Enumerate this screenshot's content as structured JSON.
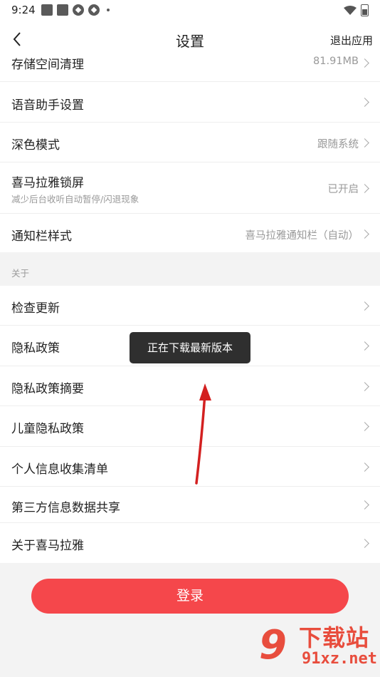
{
  "status": {
    "time": "9:24"
  },
  "header": {
    "title": "设置",
    "exit_label": "退出应用"
  },
  "settings": [
    {
      "label": "存储空间清理",
      "value": "81.91MB"
    },
    {
      "label": "语音助手设置",
      "value": ""
    },
    {
      "label": "深色模式",
      "value": "跟随系统"
    },
    {
      "label": "喜马拉雅锁屏",
      "sub": "减少后台收听自动暂停/闪退现象",
      "value": "已开启"
    },
    {
      "label": "通知栏样式",
      "value": "喜马拉雅通知栏（自动）"
    }
  ],
  "about": {
    "section_label": "关于",
    "items": [
      {
        "label": "检查更新"
      },
      {
        "label": "隐私政策"
      },
      {
        "label": "隐私政策摘要"
      },
      {
        "label": "儿童隐私政策"
      },
      {
        "label": "个人信息收集清单"
      },
      {
        "label": "第三方信息数据共享"
      },
      {
        "label": "关于喜马拉雅"
      }
    ]
  },
  "toast": {
    "text": "正在下载最新版本"
  },
  "login": {
    "label": "登录"
  },
  "watermark": {
    "top": "下载站",
    "bottom": "91xz.net",
    "nine": "9"
  },
  "colors": {
    "accent": "#f5474b",
    "background": "#f3f3f3",
    "toast": "#2f2f2f",
    "arrow": "#d32020"
  }
}
